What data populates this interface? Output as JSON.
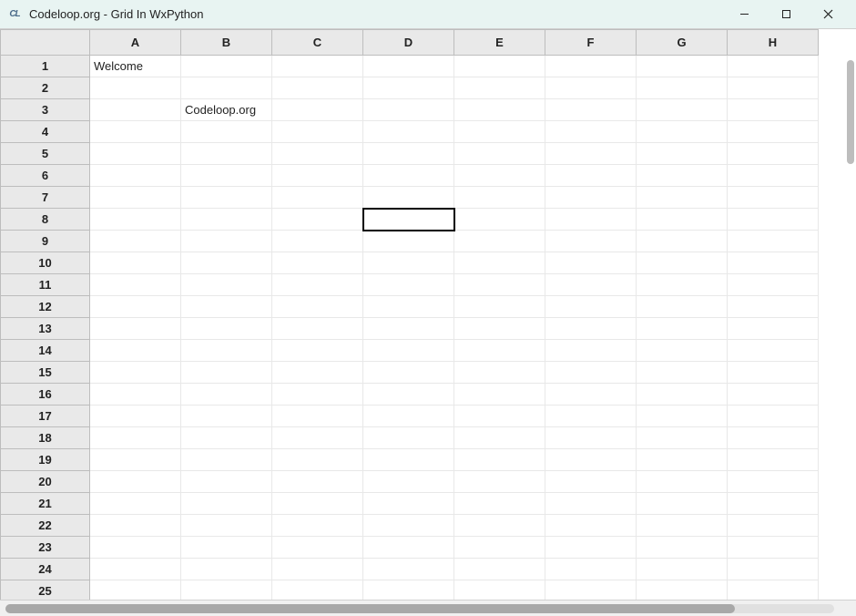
{
  "window": {
    "title": "Codeloop.org - Grid In WxPython",
    "icon_label": "CL"
  },
  "grid": {
    "columns": [
      "A",
      "B",
      "C",
      "D",
      "E",
      "F",
      "G",
      "H"
    ],
    "row_count": 25,
    "selected_cell": {
      "row": 8,
      "col": "D"
    },
    "cells": {
      "r1cA": "Welcome",
      "r3cB": "Codeloop.org"
    }
  }
}
